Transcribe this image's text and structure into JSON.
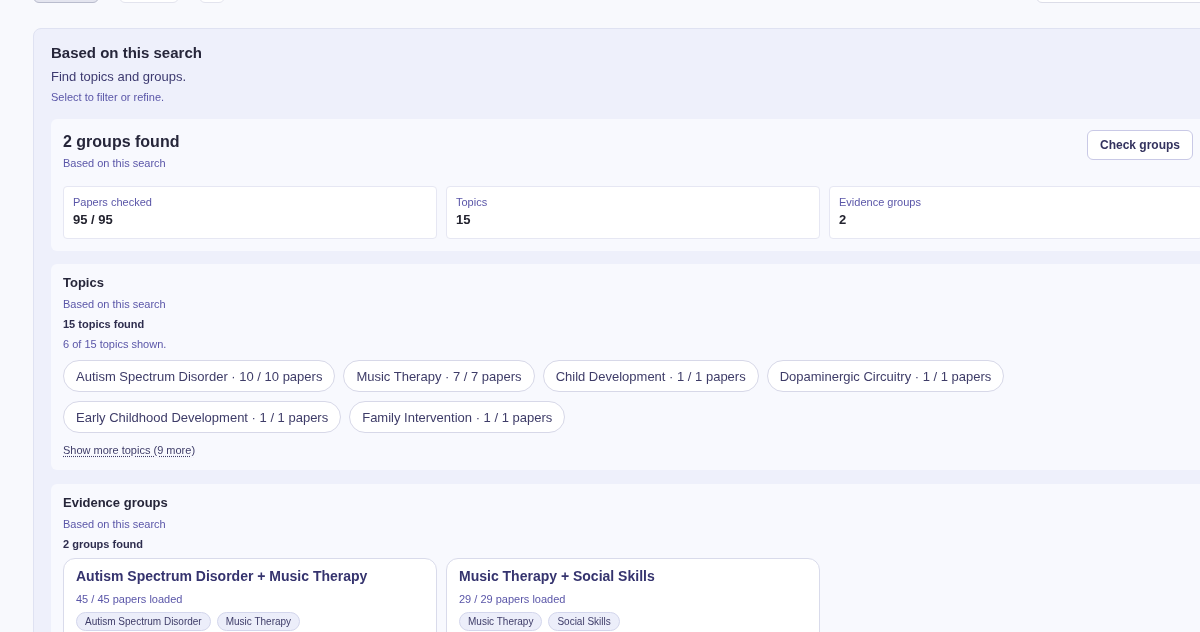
{
  "panel": {
    "title": "Based on this search",
    "subtitle": "Find topics and groups.",
    "hint": "Select to filter or refine."
  },
  "summary": {
    "title": "2 groups found",
    "caption": "Based on this search",
    "button": "Check groups",
    "stats": [
      {
        "label": "Papers checked",
        "value": "95 / 95"
      },
      {
        "label": "Topics",
        "value": "15"
      },
      {
        "label": "Evidence groups",
        "value": "2"
      }
    ]
  },
  "topics": {
    "title": "Topics",
    "caption": "Based on this search",
    "count": "15 topics found",
    "shown": "6 of 15 topics shown.",
    "chips": [
      "Autism Spectrum Disorder · 10 / 10 papers",
      "Music Therapy · 7 / 7 papers",
      "Child Development · 1 / 1 papers",
      "Dopaminergic Circuitry · 1 / 1 papers",
      "Early Childhood Development · 1 / 1 papers",
      "Family Intervention · 1 / 1 papers"
    ],
    "more_link": "Show more topics (9 more)"
  },
  "evidence_groups": {
    "title": "Evidence groups",
    "caption": "Based on this search",
    "count": "2 groups found",
    "groups": [
      {
        "title": "Autism Spectrum Disorder + Music Therapy",
        "papers": "45 / 45 papers loaded",
        "tags": [
          "Autism Spectrum Disorder",
          "Music Therapy"
        ]
      },
      {
        "title": "Music Therapy + Social Skills",
        "papers": "29 / 29 papers loaded",
        "tags": [
          "Music Therapy",
          "Social Skills"
        ]
      }
    ]
  }
}
